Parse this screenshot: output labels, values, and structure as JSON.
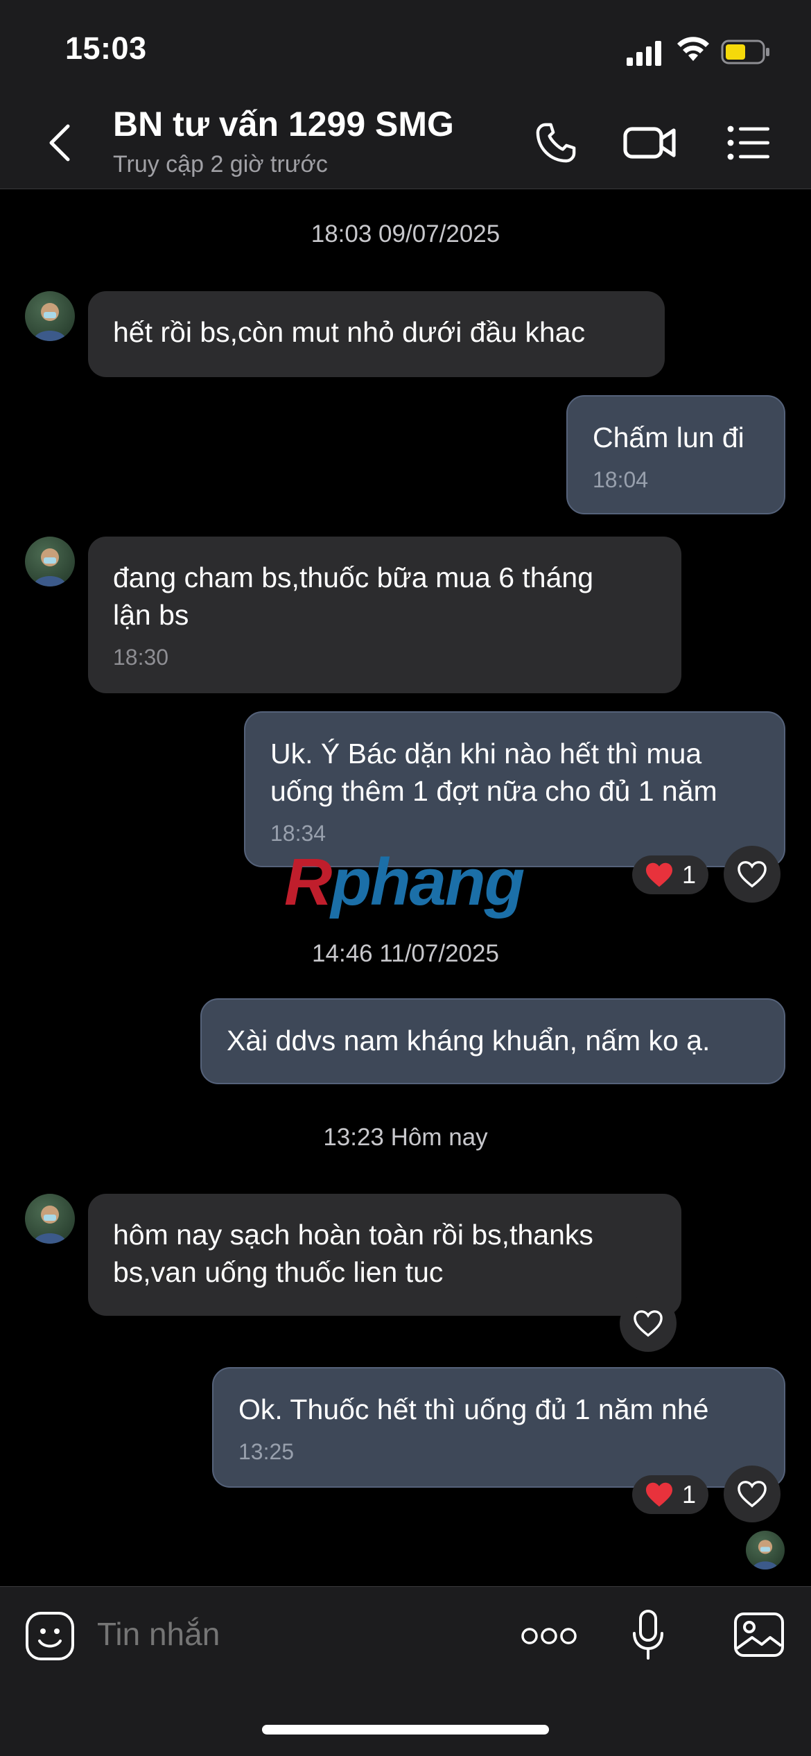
{
  "status_bar": {
    "time": "15:03"
  },
  "header": {
    "title": "BN tư vấn 1299 SMG",
    "subtitle": "Truy cập 2 giờ trước",
    "icons": [
      "back-icon",
      "phone-icon",
      "video-call-icon",
      "menu-list-icon"
    ]
  },
  "dates": {
    "d1": "18:03 09/07/2025",
    "d2": "14:46 11/07/2025",
    "d3": "13:23 Hôm nay"
  },
  "messages": [
    {
      "from": "in",
      "text": "hết rồi bs,còn mut nhỏ dưới đầu khac",
      "time": ""
    },
    {
      "from": "out",
      "text": "Chấm lun đi",
      "time": "18:04"
    },
    {
      "from": "in",
      "text": "đang cham bs,thuốc bữa mua 6 tháng\nlận bs",
      "time": "18:30"
    },
    {
      "from": "out",
      "text": "Uk. Ý Bác dặn khi nào hết thì mua\nuống thêm 1 đợt nữa cho đủ 1 năm",
      "time": "18:34",
      "reaction_count": "1"
    },
    {
      "from": "out",
      "text": "Xài ddvs nam kháng khuẩn, nấm ko ạ.",
      "time": ""
    },
    {
      "from": "in",
      "text": "hôm nay sạch hoàn toàn rồi bs,thanks\nbs,van uống thuốc lien tuc",
      "time": ""
    },
    {
      "from": "out",
      "text": "Ok. Thuốc hết thì uống đủ 1 năm nhé",
      "time": "13:25",
      "reaction_count": "1"
    }
  ],
  "watermark": {
    "part1": "R",
    "part2": "phang"
  },
  "composer": {
    "placeholder": "Tin nhắn",
    "icons": [
      "emoji-icon",
      "more-options-icon",
      "microphone-icon",
      "image-icon"
    ]
  },
  "colors": {
    "bubble_in": "#2c2c2e",
    "bubble_out": "#3e4858",
    "heart": "#e8323c",
    "battery": "#f5d90a"
  }
}
